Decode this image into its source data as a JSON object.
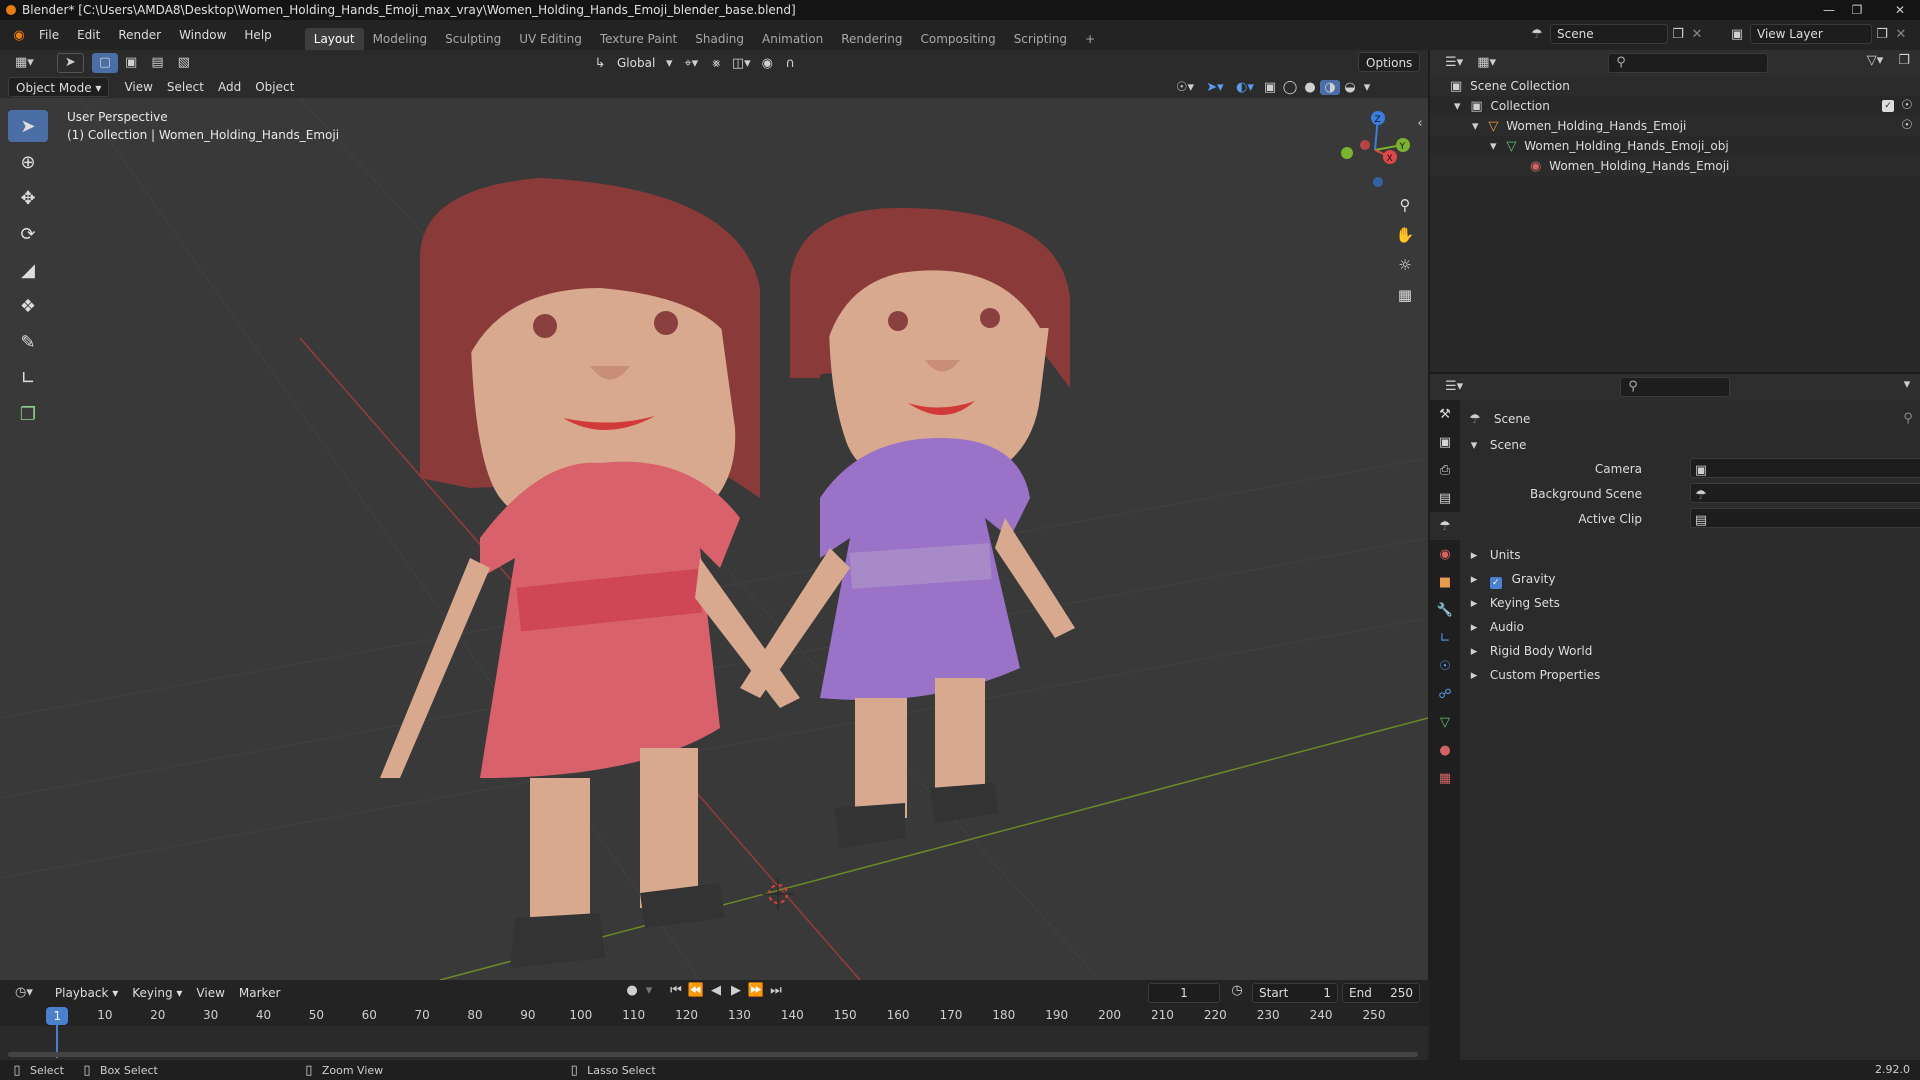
{
  "app": {
    "title": "Blender* [C:\\Users\\AMDA8\\Desktop\\Women_Holding_Hands_Emoji_max_vray\\Women_Holding_Hands_Emoji_blender_base.blend]",
    "version": "2.92.0",
    "accent": "#4b7fd0"
  },
  "menubar": {
    "items": [
      "File",
      "Edit",
      "Render",
      "Window",
      "Help"
    ],
    "workspaces": [
      "Layout",
      "Modeling",
      "Sculpting",
      "UV Editing",
      "Texture Paint",
      "Shading",
      "Animation",
      "Rendering",
      "Compositing",
      "Scripting"
    ],
    "active_workspace": "Layout",
    "add_tab": "+",
    "scene_value": "Scene",
    "view_layer_value": "View Layer"
  },
  "viewport_header": {
    "transform_orientation": "Global",
    "options_label": "Options",
    "mode": "Object Mode",
    "menus": [
      "View",
      "Select",
      "Add",
      "Object"
    ]
  },
  "viewport": {
    "perspective_label": "User Perspective",
    "collection_label": "(1) Collection | Women_Holding_Hands_Emoji",
    "gizmo": {
      "z": "Z",
      "y": "Y",
      "x": "X"
    }
  },
  "timeline": {
    "menus": [
      "Playback",
      "Keying",
      "View",
      "Marker"
    ],
    "current_frame": "1",
    "start_label": "Start",
    "start_value": "1",
    "end_label": "End",
    "end_value": "250",
    "ticks": [
      "1",
      "10",
      "20",
      "30",
      "40",
      "50",
      "60",
      "70",
      "80",
      "90",
      "100",
      "110",
      "120",
      "130",
      "140",
      "150",
      "160",
      "170",
      "180",
      "190",
      "200",
      "210",
      "220",
      "230",
      "240",
      "250"
    ],
    "playhead_frame": "1"
  },
  "statusbar": {
    "select": "Select",
    "box_select": "Box Select",
    "zoom_view": "Zoom View",
    "lasso_select": "Lasso Select"
  },
  "outliner": {
    "search_placeholder": "",
    "rows": [
      {
        "label": "Scene Collection",
        "icon": "scene-collection-icon"
      },
      {
        "label": "Collection",
        "icon": "collection-icon"
      },
      {
        "label": "Women_Holding_Hands_Emoji",
        "icon": "object-icon"
      },
      {
        "label": "Women_Holding_Hands_Emoji_obj",
        "icon": "mesh-icon"
      },
      {
        "label": "Women_Holding_Hands_Emoji",
        "icon": "material-icon"
      }
    ]
  },
  "properties": {
    "context_title": "Scene",
    "panel_title": "Scene",
    "fields": [
      {
        "label": "Camera"
      },
      {
        "label": "Background Scene"
      },
      {
        "label": "Active Clip"
      }
    ],
    "subpanels": [
      "Units",
      "Gravity",
      "Keying Sets",
      "Audio",
      "Rigid Body World",
      "Custom Properties"
    ],
    "gravity_checked": true
  }
}
